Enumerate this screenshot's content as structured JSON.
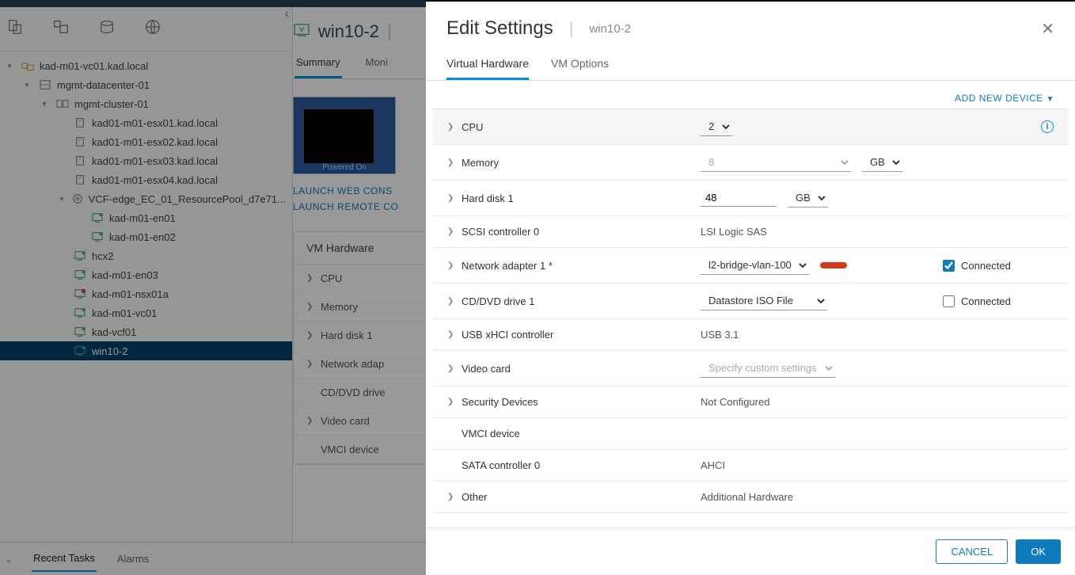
{
  "sidebar": {
    "tree": [
      {
        "level": 0,
        "icon": "vcenter",
        "label": "kad-m01-vc01.kad.local",
        "expanded": true
      },
      {
        "level": 1,
        "icon": "datacenter",
        "label": "mgmt-datacenter-01",
        "expanded": true
      },
      {
        "level": 2,
        "icon": "cluster",
        "label": "mgmt-cluster-01",
        "expanded": true
      },
      {
        "level": 3,
        "icon": "host",
        "label": "kad01-m01-esx01.kad.local"
      },
      {
        "level": 3,
        "icon": "host",
        "label": "kad01-m01-esx02.kad.local"
      },
      {
        "level": 3,
        "icon": "host",
        "label": "kad01-m01-esx03.kad.local"
      },
      {
        "level": 3,
        "icon": "host",
        "label": "kad01-m01-esx04.kad.local"
      },
      {
        "level": 3,
        "icon": "respool",
        "label": "VCF-edge_EC_01_ResourcePool_d7e71...",
        "expanded": true
      },
      {
        "level": 4,
        "icon": "vm-on",
        "label": "kad-m01-en01"
      },
      {
        "level": 4,
        "icon": "vm-on",
        "label": "kad-m01-en02"
      },
      {
        "level": 3,
        "icon": "vm-on",
        "label": "hcx2"
      },
      {
        "level": 3,
        "icon": "vm-on",
        "label": "kad-m01-en03"
      },
      {
        "level": 3,
        "icon": "vm-alert",
        "label": "kad-m01-nsx01a"
      },
      {
        "level": 3,
        "icon": "vm-on",
        "label": "kad-m01-vc01"
      },
      {
        "level": 3,
        "icon": "vm-on",
        "label": "kad-vcf01"
      },
      {
        "level": 3,
        "icon": "vm-on",
        "label": "win10-2",
        "selected": true
      }
    ]
  },
  "detail": {
    "title": "win10-2",
    "tabs": {
      "summary": "Summary",
      "monitor": "Moni"
    },
    "thumb_label": "Powered On",
    "launch_web": "LAUNCH WEB CONS",
    "launch_remote": "LAUNCH REMOTE CO",
    "hw_card": {
      "title": "VM Hardware",
      "rows": [
        "CPU",
        "Memory",
        "Hard disk 1",
        "Network adap",
        "CD/DVD drive",
        "Video card",
        "VMCI device"
      ]
    }
  },
  "bottom": {
    "recent": "Recent Tasks",
    "alarms": "Alarms"
  },
  "modal": {
    "title": "Edit Settings",
    "subtitle": "win10-2",
    "tabs": {
      "hw": "Virtual Hardware",
      "opts": "VM Options"
    },
    "add_device": "ADD NEW DEVICE",
    "ok": "OK",
    "cancel": "CANCEL",
    "rows": {
      "cpu": {
        "label": "CPU",
        "value": "2"
      },
      "memory": {
        "label": "Memory",
        "value": "8",
        "unit": "GB"
      },
      "disk": {
        "label": "Hard disk 1",
        "value": "48",
        "unit": "GB"
      },
      "scsi": {
        "label": "SCSI controller 0",
        "value": "LSI Logic SAS"
      },
      "net": {
        "label": "Network adapter 1 *",
        "value": "l2-bridge-vlan-100",
        "connected": "Connected",
        "checked": true
      },
      "cdrom": {
        "label": "CD/DVD drive 1",
        "value": "Datastore ISO File",
        "connected": "Connected",
        "checked": false
      },
      "usb": {
        "label": "USB xHCI controller",
        "value": "USB 3.1"
      },
      "video": {
        "label": "Video card",
        "value": "Specify custom settings"
      },
      "sec": {
        "label": "Security Devices",
        "value": "Not Configured"
      },
      "vmci": {
        "label": "VMCI device",
        "value": ""
      },
      "sata": {
        "label": "SATA controller 0",
        "value": "AHCI"
      },
      "other": {
        "label": "Other",
        "value": "Additional Hardware"
      }
    }
  }
}
